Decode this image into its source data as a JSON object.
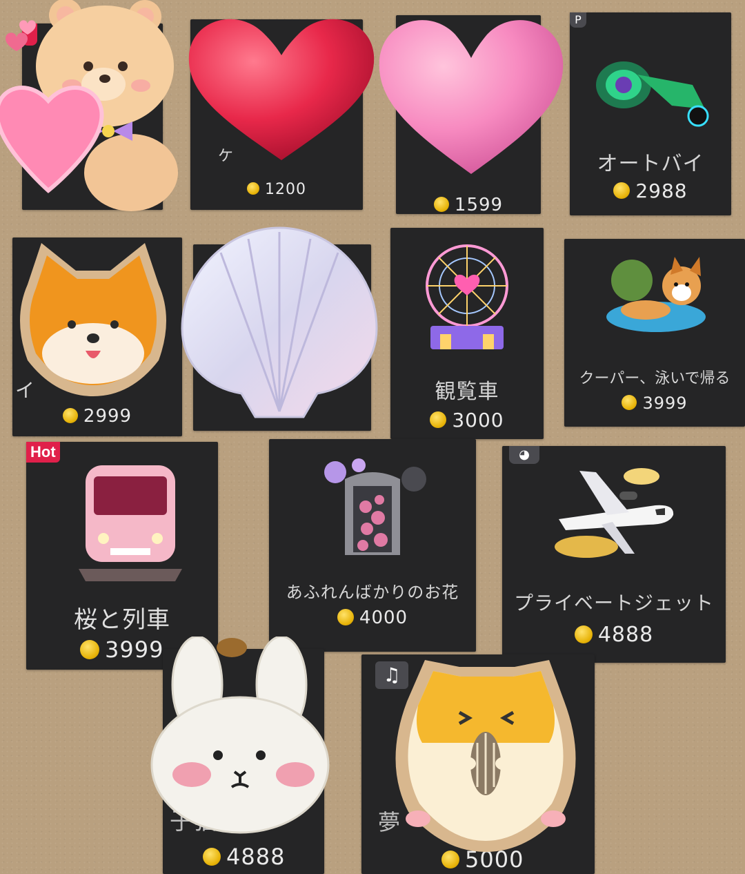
{
  "gifts": [
    {
      "label": "",
      "price": ""
    },
    {
      "label": "ケ",
      "price": "1200"
    },
    {
      "label": "",
      "price": "1599"
    },
    {
      "label": "オートバイ",
      "price": "2988"
    },
    {
      "label": "イ",
      "price": "2999"
    },
    {
      "label": "",
      "price": ""
    },
    {
      "label": "観覧車",
      "price": "3000"
    },
    {
      "label": "クーパー、泳いで帰る",
      "price": "3999"
    },
    {
      "label": "桜と列車",
      "price": "3999",
      "tag": "Hot"
    },
    {
      "label": "あふれんばかりのお花",
      "price": "4000"
    },
    {
      "label": "プライベートジェット",
      "price": "4888"
    },
    {
      "label": "子猫",
      "price": "4888"
    },
    {
      "label": "夢",
      "price": "5000"
    }
  ],
  "colors": {
    "background": "#b9a07f",
    "card": "#252526",
    "coin": "#e7b308",
    "hot": "#e0204a"
  },
  "icons": [
    "coin-icon",
    "motorcycle-icon",
    "ferris-wheel-icon",
    "corgi-icon",
    "train-icon",
    "flower-icon",
    "jet-icon",
    "music-note-icon",
    "palette-icon"
  ]
}
